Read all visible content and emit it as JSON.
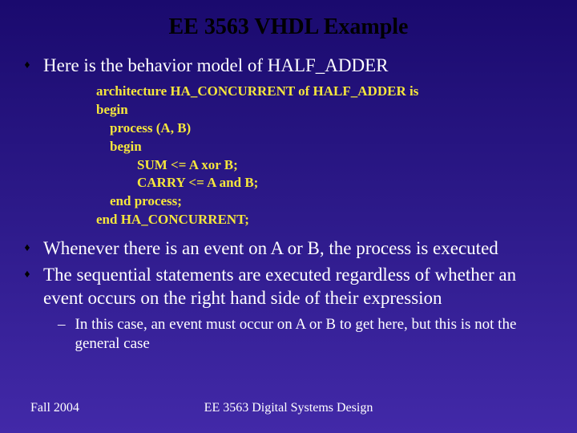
{
  "title": "EE 3563 VHDL Example",
  "bullets": {
    "b1": "Here is the behavior model of HALF_ADDER",
    "b2": "Whenever there is an event on A or B, the process is executed",
    "b3": "The sequential statements are executed regardless of whether an event occurs on the right hand side of their expression"
  },
  "code": "architecture HA_CONCURRENT of HALF_ADDER is\nbegin\n    process (A, B)\n    begin\n            SUM <= A xor B;\n            CARRY <= A and B;\n    end process;\nend HA_CONCURRENT;",
  "sub1": "In this case, an event must occur on A or B to get here, but this is not the general case",
  "footer": {
    "left": "Fall 2004",
    "center": "EE 3563 Digital Systems Design"
  }
}
